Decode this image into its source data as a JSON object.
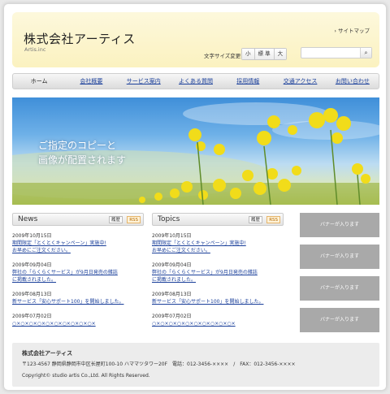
{
  "header": {
    "title": "株式会社アーティス",
    "subtitle": "Artis.inc",
    "sitemap": "サイトマップ",
    "fontsize_label": "文字サイズ変更",
    "fontsize_options": [
      "小",
      "標 準",
      "大"
    ],
    "search_placeholder": ""
  },
  "nav": {
    "items": [
      "ホーム",
      "会社概要",
      "サービス案内",
      "よくある質問",
      "採用情報",
      "交通アクセス",
      "お問い合わせ"
    ]
  },
  "hero": {
    "line1": "ご指定のコピーと",
    "line2": "画像が配置されます"
  },
  "news": {
    "title": "News",
    "history": "履歴",
    "rss": "RSS",
    "entries": [
      {
        "date": "2009年10月15日",
        "lines": [
          "期間限定「とくとくキャンペーン」実施中!",
          "お早めにご注文ください。"
        ]
      },
      {
        "date": "2009年09月04日",
        "lines": [
          "弊社の「らくらくサービス」が9月日発売の雑誌",
          "に掲載されました。"
        ]
      },
      {
        "date": "2009年08月13日",
        "lines": [
          "新サービス「安心サポート100」を開始しました。"
        ]
      },
      {
        "date": "2009年07月02日",
        "lines": [
          "○×○×○×○×○×○×○×○×○×○×"
        ]
      }
    ]
  },
  "topics": {
    "title": "Topics",
    "history": "履歴",
    "rss": "RSS",
    "entries": [
      {
        "date": "2009年10月15日",
        "lines": [
          "期間限定「とくとくキャンペーン」実施中!",
          "お早めにご注文ください。"
        ]
      },
      {
        "date": "2009年09月04日",
        "lines": [
          "弊社の「らくらくサービス」が9月日発売の雑誌",
          "に掲載されました。"
        ]
      },
      {
        "date": "2009年08月13日",
        "lines": [
          "新サービス「安心サポート100」を開始しました。"
        ]
      },
      {
        "date": "2009年07月02日",
        "lines": [
          "○×○×○×○×○×○×○×○×○×○×"
        ]
      }
    ]
  },
  "banners": [
    "バナーが入ります",
    "バナーが入ります",
    "バナーが入ります",
    "バナーが入ります"
  ],
  "footer": {
    "name": "株式会社アーティス",
    "address": "〒123-4567 静岡県静岡市中区长屋町100-10 ハママツタワー20F　電話：012-3456-××××　/　FAX：012-3456-××××",
    "copyright": "Copyright© studio artis Co.,Ltd. All Rights Reserved."
  },
  "colors": {
    "header_bg": "#fbf2c0",
    "link": "#1a3f9a",
    "banner": "#a9a9a9"
  }
}
